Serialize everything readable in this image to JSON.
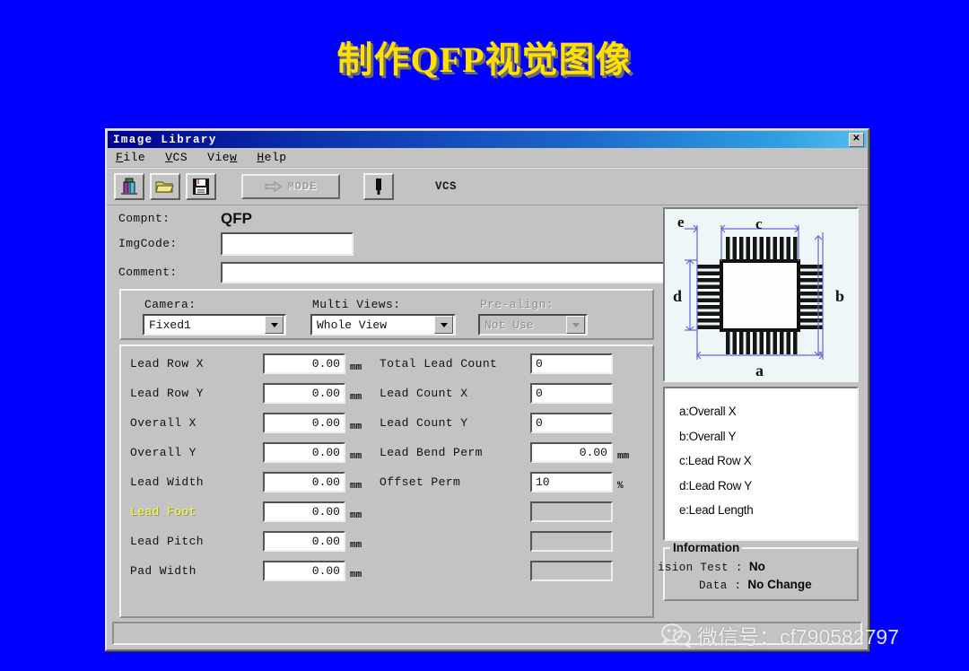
{
  "slide": {
    "title": "制作QFP视觉图像",
    "background_color": "#0000ff",
    "title_color": "#ffe000"
  },
  "window": {
    "title": "Image Library",
    "close_label": "✕"
  },
  "menu": {
    "items": [
      {
        "accel": "F",
        "rest": "ile"
      },
      {
        "accel": "V",
        "rest": "CS"
      },
      {
        "accel": "Vie",
        "rest": "w",
        "pre": true
      },
      {
        "accel": "H",
        "rest": "elp"
      }
    ],
    "labels": [
      "File",
      "VCS",
      "View",
      "Help"
    ]
  },
  "toolbar": {
    "buttons": [
      "new-image-button",
      "open-button",
      "save-button"
    ],
    "mode_label": "MODE",
    "probe_button": "probe-button",
    "vcs_label": "VCS"
  },
  "header_fields": {
    "compnt_label": "Compnt:",
    "compnt_value": "QFP",
    "imgcode_label": "ImgCode:",
    "imgcode_value": "",
    "imgcode_placeholder": "",
    "comment_label": "Comment:",
    "comment_value": "",
    "comment_placeholder": ""
  },
  "camera_group": {
    "camera_label": "Camera:",
    "camera_value": "Fixed1",
    "camera_options": [
      "Fixed1"
    ],
    "multiviews_label": "Multi Views:",
    "multiviews_value": "Whole View",
    "multiviews_options": [
      "Whole View"
    ],
    "prealign_label": "Pre-align:",
    "prealign_value": "Not Use",
    "prealign_options": [
      "Not Use"
    ],
    "prealign_disabled": true
  },
  "params_left": [
    {
      "name": "Lead Row X",
      "value": "0.00",
      "unit": "mm",
      "highlight": false
    },
    {
      "name": "Lead Row Y",
      "value": "0.00",
      "unit": "mm",
      "highlight": false
    },
    {
      "name": "Overall X",
      "value": "0.00",
      "unit": "mm",
      "highlight": false
    },
    {
      "name": "Overall Y",
      "value": "0.00",
      "unit": "mm",
      "highlight": false
    },
    {
      "name": "Lead Width",
      "value": "0.00",
      "unit": "mm",
      "highlight": false
    },
    {
      "name": "Lead Foot",
      "value": "0.00",
      "unit": "mm",
      "highlight": true
    },
    {
      "name": "Lead Pitch",
      "value": "0.00",
      "unit": "mm",
      "highlight": false
    },
    {
      "name": "Pad Width",
      "value": "0.00",
      "unit": "mm",
      "highlight": false
    }
  ],
  "params_right": [
    {
      "name": "Total Lead Count",
      "value": "0",
      "unit": "",
      "align": "left",
      "blank": false
    },
    {
      "name": "Lead Count X",
      "value": "0",
      "unit": "",
      "align": "left",
      "blank": false
    },
    {
      "name": "Lead Count Y",
      "value": "0",
      "unit": "",
      "align": "left",
      "blank": false
    },
    {
      "name": "Lead Bend Perm",
      "value": "0.00",
      "unit": "mm",
      "align": "right",
      "blank": false
    },
    {
      "name": "Offset Perm",
      "value": "10",
      "unit": "%",
      "align": "left",
      "blank": false
    },
    {
      "name": "",
      "value": "",
      "unit": "",
      "align": "left",
      "blank": true
    },
    {
      "name": "",
      "value": "",
      "unit": "",
      "align": "left",
      "blank": true
    },
    {
      "name": "",
      "value": "",
      "unit": "",
      "align": "left",
      "blank": true
    }
  ],
  "diagram": {
    "markers": {
      "a": "a",
      "b": "b",
      "c": "c",
      "d": "d",
      "e": "e"
    },
    "dimension_color": "#5a5ad0",
    "body_color": "#1a1a1a",
    "leads_per_side": 11
  },
  "legend": [
    "a:Overall X",
    "b:Overall Y",
    "c:Lead Row X",
    "d:Lead Row Y",
    "e:Lead Length"
  ],
  "information": {
    "title": "Information",
    "rows": [
      {
        "key": "ision Test :",
        "value": "No"
      },
      {
        "key": "Data :",
        "value": "No Change"
      }
    ]
  },
  "watermark": {
    "text": "微信号：cf790582797",
    "icon": "wechat-icon"
  }
}
